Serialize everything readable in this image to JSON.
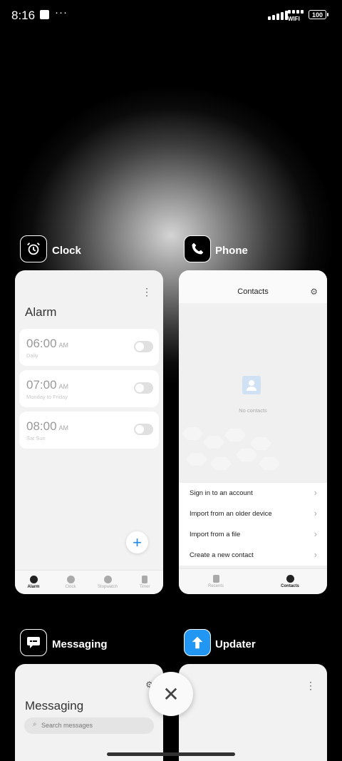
{
  "status": {
    "time": "8:16",
    "more": "···",
    "wifi": "WIFI",
    "battery": "100"
  },
  "apps": [
    {
      "name": "Clock",
      "icon": "alarm-clock-icon"
    },
    {
      "name": "Phone",
      "icon": "phone-handset-icon"
    },
    {
      "name": "Messaging",
      "icon": "message-bubble-icon"
    },
    {
      "name": "Updater",
      "icon": "arrow-up-icon"
    }
  ],
  "clock": {
    "title": "Alarm",
    "alarms": [
      {
        "time": "06:00",
        "ampm": "AM",
        "repeat": "Daily"
      },
      {
        "time": "07:00",
        "ampm": "AM",
        "repeat": "Monday to Friday"
      },
      {
        "time": "08:00",
        "ampm": "AM",
        "repeat": "Sat Sun"
      }
    ],
    "tabs": [
      "Alarm",
      "Clock",
      "Stopwatch",
      "Timer"
    ],
    "fab": "+"
  },
  "phone": {
    "title": "Contacts",
    "empty": "No contacts",
    "menu": [
      "Sign in to an account",
      "Import from an older device",
      "Import from a file",
      "Create a new contact"
    ],
    "tabs": [
      "Recents",
      "Contacts"
    ]
  },
  "messaging": {
    "title": "Messaging",
    "search_placeholder": "Search messages"
  },
  "close": "✕",
  "colors": {
    "accent": "#1e88e5",
    "updater_icon": "#2196f3"
  }
}
